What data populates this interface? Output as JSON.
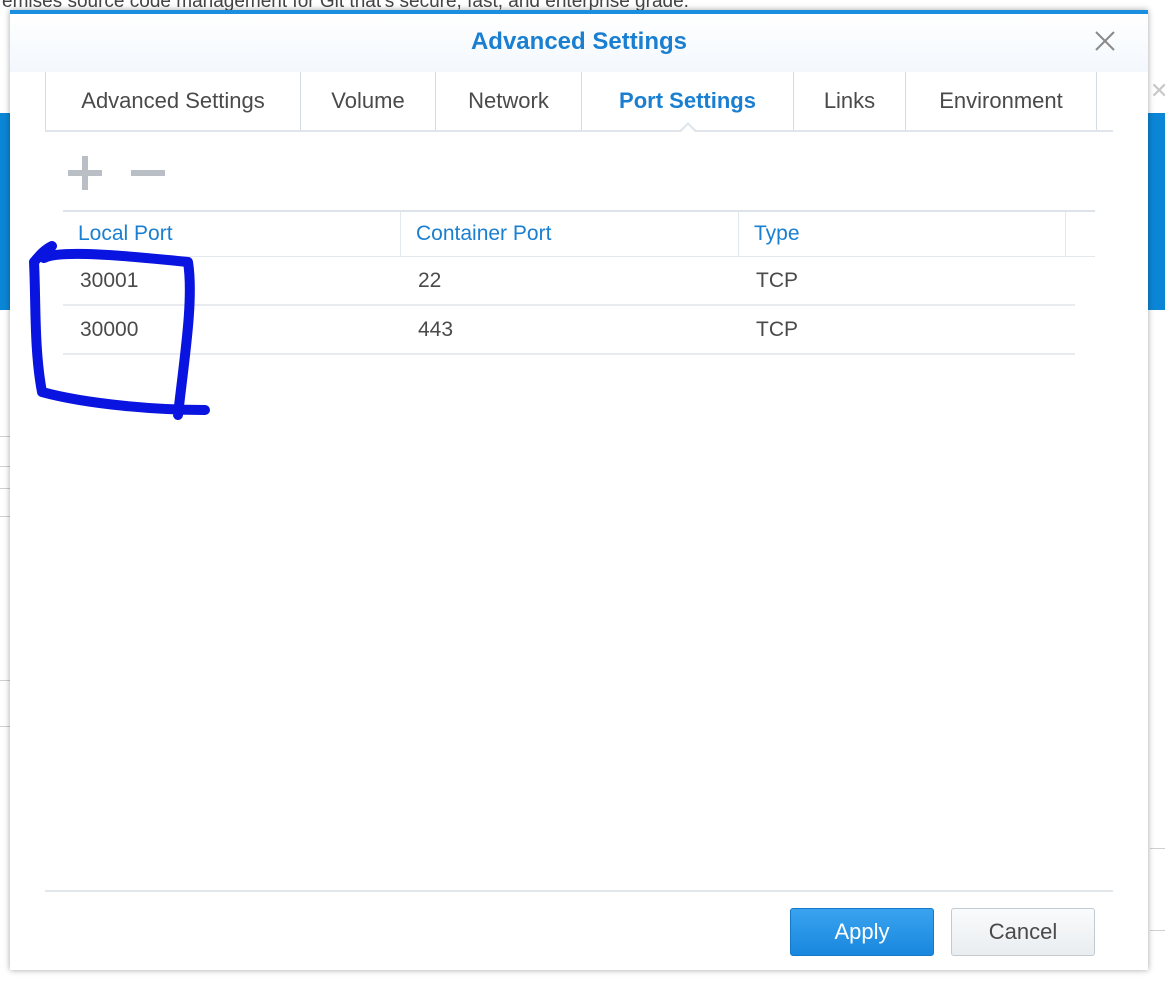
{
  "background": {
    "top_text": "emises source code management for Git that's secure, fast, and enterprise grade."
  },
  "dialog": {
    "title": "Advanced Settings",
    "tabs": [
      {
        "label": "Advanced Settings",
        "active": false
      },
      {
        "label": "Volume",
        "active": false
      },
      {
        "label": "Network",
        "active": false
      },
      {
        "label": "Port Settings",
        "active": true
      },
      {
        "label": "Links",
        "active": false
      },
      {
        "label": "Environment",
        "active": false
      }
    ],
    "toolbar": {
      "add_icon": "plus-icon",
      "remove_icon": "minus-icon"
    },
    "table": {
      "columns": [
        "Local Port",
        "Container Port",
        "Type"
      ],
      "rows": [
        {
          "local_port": "30001",
          "container_port": "22",
          "type": "TCP"
        },
        {
          "local_port": "30000",
          "container_port": "443",
          "type": "TCP"
        }
      ]
    },
    "buttons": {
      "apply": "Apply",
      "cancel": "Cancel"
    }
  },
  "colors": {
    "accent": "#1a7fd0",
    "apply_button": "#1887dd",
    "annotation_stroke": "#0a14e0"
  }
}
